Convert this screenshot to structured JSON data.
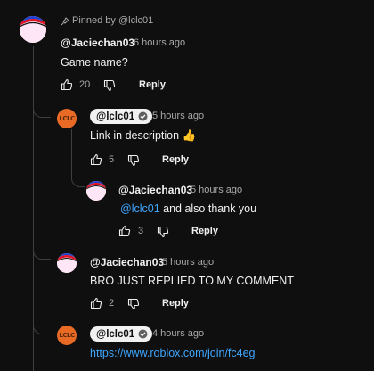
{
  "comments": [
    {
      "pinned_label": "Pinned by @lclc01",
      "author": "@Jaciechan03",
      "time": "6 hours ago",
      "text": "Game name?",
      "likes": "20",
      "reply_label": "Reply"
    },
    {
      "author": "@lclc01",
      "time": "5 hours ago",
      "text": "Link in description 👍",
      "likes": "5",
      "reply_label": "Reply"
    },
    {
      "author": "@Jaciechan03",
      "time": "5 hours ago",
      "mention": "@lclc01",
      "text": " and also thank you",
      "likes": "3",
      "reply_label": "Reply"
    },
    {
      "author": "@Jaciechan03",
      "time": "5 hours ago",
      "text": "BRO JUST REPLIED TO MY COMMENT",
      "likes": "2",
      "reply_label": "Reply"
    },
    {
      "author": "@lclc01",
      "time": "4 hours ago",
      "link": "https://www.roblox.com/join/fc4eg"
    }
  ],
  "avatar_lclc_text": "LCLC",
  "colors": {
    "background": "#0f0f0f",
    "link": "#3ea6ff",
    "thread_line": "#3f3f3f",
    "avatar_lclc": "#e86a25"
  }
}
